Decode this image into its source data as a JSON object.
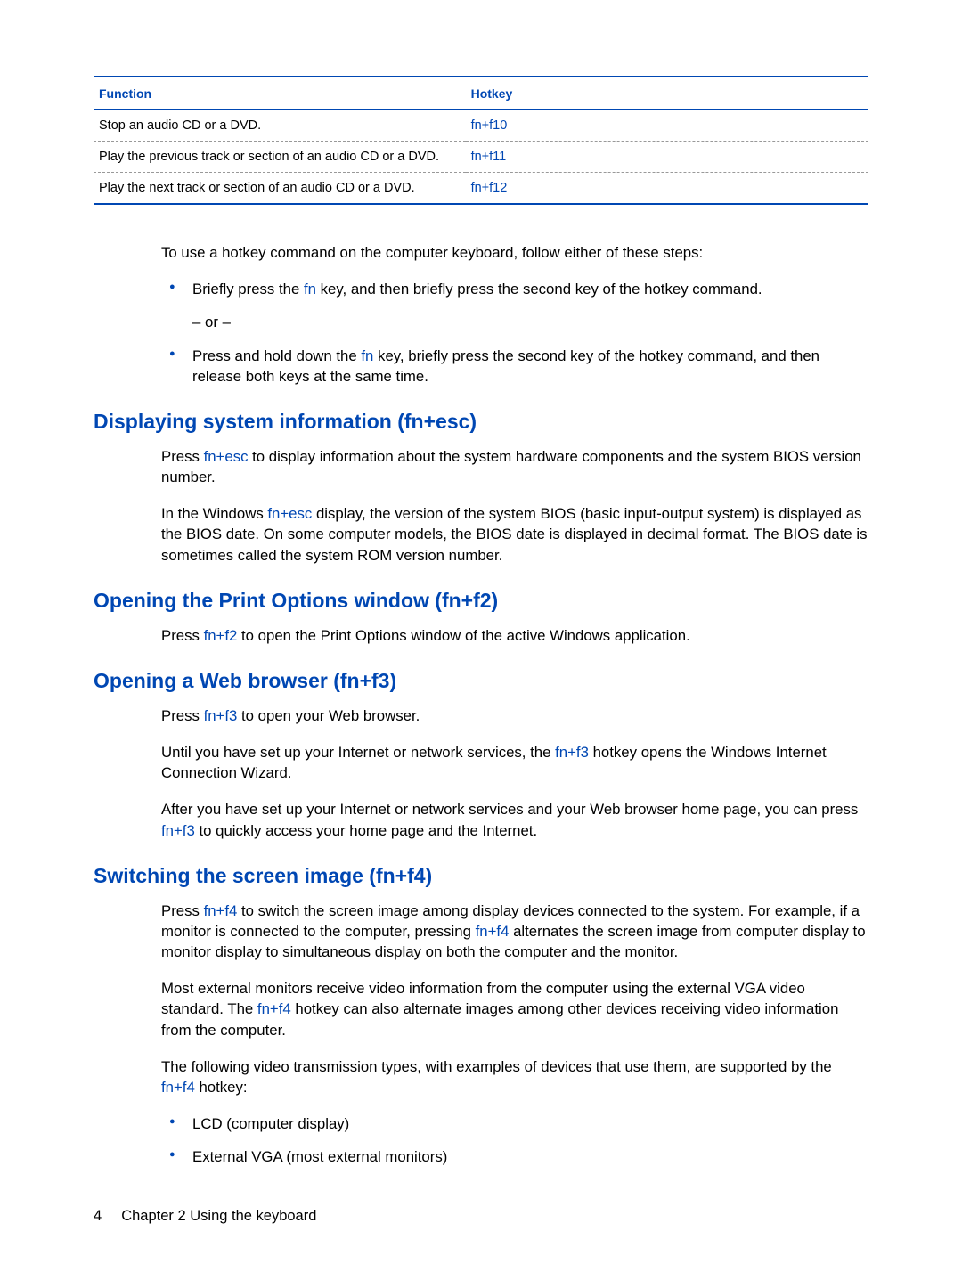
{
  "table": {
    "headers": {
      "function": "Function",
      "hotkey": "Hotkey"
    },
    "rows": [
      {
        "function": "Stop an audio CD or a DVD.",
        "hotkey": "fn+f10"
      },
      {
        "function": "Play the previous track or section of an audio CD or a DVD.",
        "hotkey": "fn+f11"
      },
      {
        "function": "Play the next track or section of an audio CD or a DVD.",
        "hotkey": "fn+f12"
      }
    ]
  },
  "intro": {
    "lead": "To use a hotkey command on the computer keyboard, follow either of these steps:",
    "bullet1_a": "Briefly press the ",
    "bullet1_key": "fn",
    "bullet1_b": " key, and then briefly press the second key of the hotkey command.",
    "or": "– or –",
    "bullet2_a": "Press and hold down the ",
    "bullet2_key": "fn",
    "bullet2_b": " key, briefly press the second key of the hotkey command, and then release both keys at the same time."
  },
  "sec1": {
    "title": "Displaying system information (fn+esc)",
    "p1_a": "Press ",
    "p1_key": "fn+esc",
    "p1_b": " to display information about the system hardware components and the system BIOS version number.",
    "p2_a": "In the Windows ",
    "p2_key": "fn+esc",
    "p2_b": " display, the version of the system BIOS (basic input-output system) is displayed as the BIOS date. On some computer models, the BIOS date is displayed in decimal format. The BIOS date is sometimes called the system ROM version number."
  },
  "sec2": {
    "title": "Opening the Print Options window (fn+f2)",
    "p1_a": "Press ",
    "p1_key": "fn+f2",
    "p1_b": " to open the Print Options window of the active Windows application."
  },
  "sec3": {
    "title": "Opening a Web browser (fn+f3)",
    "p1_a": "Press ",
    "p1_key": "fn+f3",
    "p1_b": " to open your Web browser.",
    "p2_a": "Until you have set up your Internet or network services, the ",
    "p2_key": "fn+f3",
    "p2_b": " hotkey opens the Windows Internet Connection Wizard.",
    "p3_a": "After you have set up your Internet or network services and your Web browser home page, you can press ",
    "p3_key": "fn+f3",
    "p3_b": " to quickly access your home page and the Internet."
  },
  "sec4": {
    "title": "Switching the screen image (fn+f4)",
    "p1_a": "Press ",
    "p1_key1": "fn+f4",
    "p1_b": " to switch the screen image among display devices connected to the system. For example, if a monitor is connected to the computer, pressing ",
    "p1_key2": "fn+f4",
    "p1_c": " alternates the screen image from computer display to monitor display to simultaneous display on both the computer and the monitor.",
    "p2_a": "Most external monitors receive video information from the computer using the external VGA video standard. The ",
    "p2_key": "fn+f4",
    "p2_b": " hotkey can also alternate images among other devices receiving video information from the computer.",
    "p3_a": "The following video transmission types, with examples of devices that use them, are supported by the ",
    "p3_key": "fn+f4",
    "p3_b": " hotkey:",
    "bullet1": "LCD (computer display)",
    "bullet2": "External VGA (most external monitors)"
  },
  "footer": {
    "page": "4",
    "chapter": "Chapter 2   Using the keyboard"
  }
}
